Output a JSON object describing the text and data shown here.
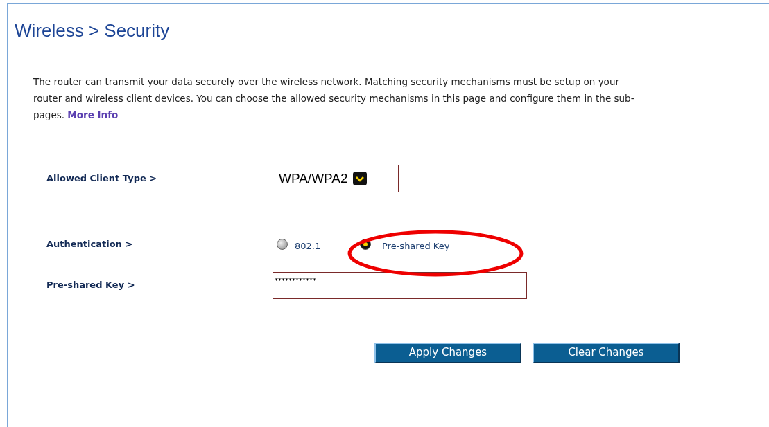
{
  "page_title": "Wireless > Security",
  "intro": {
    "text": "The router can transmit your data securely over the wireless network. Matching security mechanisms must be setup on your router and wireless client devices. You can choose the allowed security mechanisms in this page and configure them in the sub-pages.",
    "link": "More Info"
  },
  "allowed_client_type": {
    "label": "Allowed Client Type >",
    "value": "WPA/WPA2"
  },
  "authentication": {
    "label": "Authentication >",
    "options": [
      {
        "label": "802.1",
        "selected": false
      },
      {
        "label": "Pre-shared Key",
        "selected": true
      }
    ]
  },
  "pre_shared_key": {
    "label": "Pre-shared Key >",
    "value": "************"
  },
  "buttons": [
    "Apply Changes",
    "Clear Changes"
  ]
}
